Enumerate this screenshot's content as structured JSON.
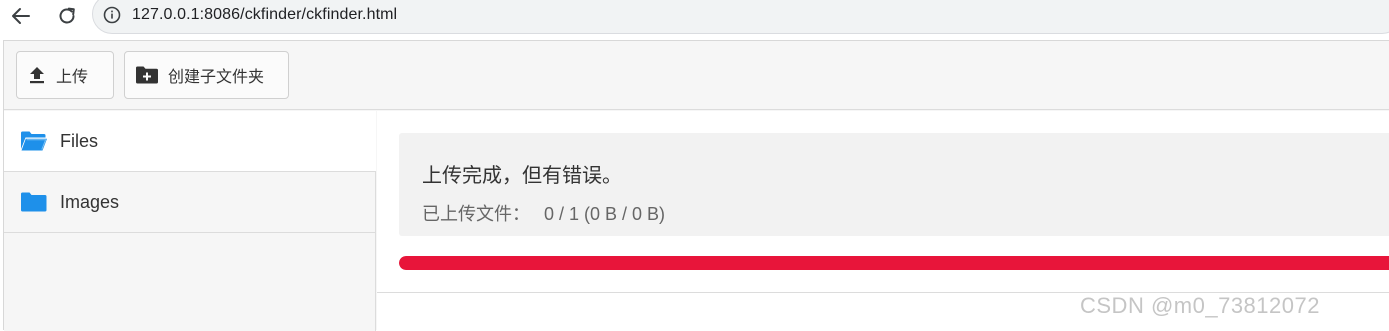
{
  "browser": {
    "url": "127.0.0.1:8086/ckfinder/ckfinder.html",
    "icons": {
      "back": "arrow-left-icon",
      "reload": "reload-icon",
      "info": "info-circle-icon"
    }
  },
  "toolbar": {
    "upload_label": "上传",
    "new_folder_label": "创建子文件夹"
  },
  "sidebar": {
    "items": [
      {
        "label": "Files",
        "icon": "folder-open-icon"
      },
      {
        "label": "Images",
        "icon": "folder-icon"
      }
    ]
  },
  "upload_status": {
    "title": "上传完成，但有错误。",
    "detail_label": "已上传文件：",
    "detail_value": "0 / 1 (0 B / 0 B)",
    "progress_percent": 100,
    "progress_color": "#e8153a"
  },
  "colors": {
    "folder": "#1e90ea",
    "accent_error": "#e8153a"
  },
  "watermark": "CSDN @m0_73812072"
}
